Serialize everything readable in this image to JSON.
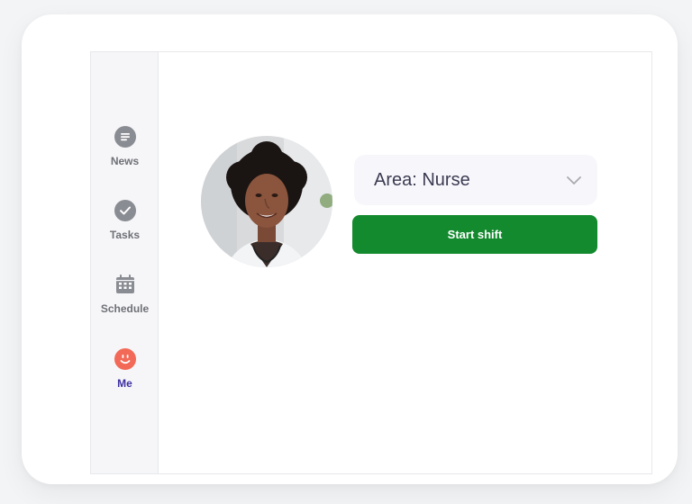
{
  "sidebar": {
    "items": [
      {
        "label": "News",
        "icon": "news-icon",
        "active": false
      },
      {
        "label": "Tasks",
        "icon": "check-circle-icon",
        "active": false
      },
      {
        "label": "Schedule",
        "icon": "calendar-icon",
        "active": false
      },
      {
        "label": "Me",
        "icon": "smiley-face-icon",
        "active": true
      }
    ]
  },
  "profile": {
    "avatar": "profile-photo"
  },
  "area_select": {
    "value": "Area: Nurse"
  },
  "actions": {
    "start_label": "Start shift"
  },
  "colors": {
    "primary": "#138a2e",
    "active_nav": "#3d2fa0",
    "me_icon": "#f26957",
    "sidebar_bg": "#f6f6f8"
  }
}
